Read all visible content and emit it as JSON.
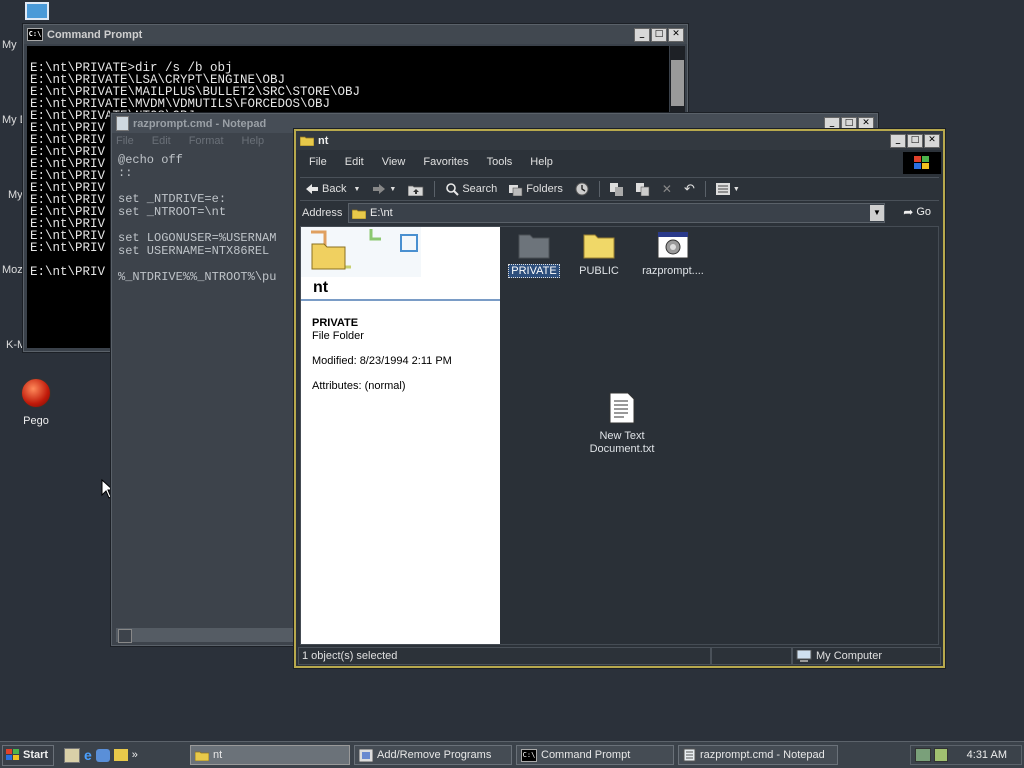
{
  "desktop": {
    "fragments": [
      "My",
      "My D",
      "My",
      "Moz",
      "K-M"
    ],
    "pego_label": "Pego"
  },
  "cmd": {
    "title": "Command Prompt",
    "lines": [
      "",
      "E:\\nt\\PRIVATE>dir /s /b obj",
      "E:\\nt\\PRIVATE\\LSA\\CRYPT\\ENGINE\\OBJ",
      "E:\\nt\\PRIVATE\\MAILPLUS\\BULLET2\\SRC\\STORE\\OBJ",
      "E:\\nt\\PRIVATE\\MVDM\\VDMUTILS\\FORCEDOS\\OBJ",
      "E:\\nt\\PRIVATE\\NTOS\\OBJ",
      "E:\\nt\\PRIV",
      "E:\\nt\\PRIV",
      "E:\\nt\\PRIV",
      "E:\\nt\\PRIV",
      "E:\\nt\\PRIV",
      "E:\\nt\\PRIV",
      "E:\\nt\\PRIV",
      "E:\\nt\\PRIV",
      "E:\\nt\\PRIV",
      "E:\\nt\\PRIV",
      "E:\\nt\\PRIV",
      "",
      "E:\\nt\\PRIV"
    ]
  },
  "notepad": {
    "title": "razprompt.cmd - Notepad",
    "menu": [
      "File",
      "Edit",
      "Format",
      "Help"
    ],
    "lines": [
      "@echo off",
      "::",
      "",
      "set _NTDRIVE=e:",
      "set _NTROOT=\\nt",
      "",
      "set LOGONUSER=%USERNAM",
      "set USERNAME=NTX86REL",
      "",
      "%_NTDRIVE%%_NTROOT%\\pu"
    ]
  },
  "explorer": {
    "title": "nt",
    "menu": [
      "File",
      "Edit",
      "View",
      "Favorites",
      "Tools",
      "Help"
    ],
    "toolbar": {
      "back": "Back",
      "search": "Search",
      "folders": "Folders"
    },
    "address_label": "Address",
    "address_value": "E:\\nt",
    "go_label": "Go",
    "webview": {
      "folder_name": "nt",
      "selected_name": "PRIVATE",
      "selected_type": "File Folder",
      "modified": "Modified: 8/23/1994 2:11 PM",
      "attributes": "Attributes: (normal)"
    },
    "items": [
      {
        "name": "PRIVATE",
        "type": "folder",
        "selected": true
      },
      {
        "name": "PUBLIC",
        "type": "folder",
        "selected": false
      },
      {
        "name": "razprompt....",
        "type": "cmd-script",
        "selected": false
      },
      {
        "name": "New Text Document.txt",
        "type": "text-file",
        "selected": false
      }
    ],
    "status_left": "1 object(s) selected",
    "status_right": "My Computer"
  },
  "taskbar": {
    "start_label": "Start",
    "tasks": [
      {
        "label": "nt",
        "active": true
      },
      {
        "label": "Add/Remove Programs",
        "active": false
      },
      {
        "label": "Command Prompt",
        "active": false
      },
      {
        "label": "razprompt.cmd - Notepad",
        "active": false
      }
    ],
    "clock": "4:31 AM"
  }
}
